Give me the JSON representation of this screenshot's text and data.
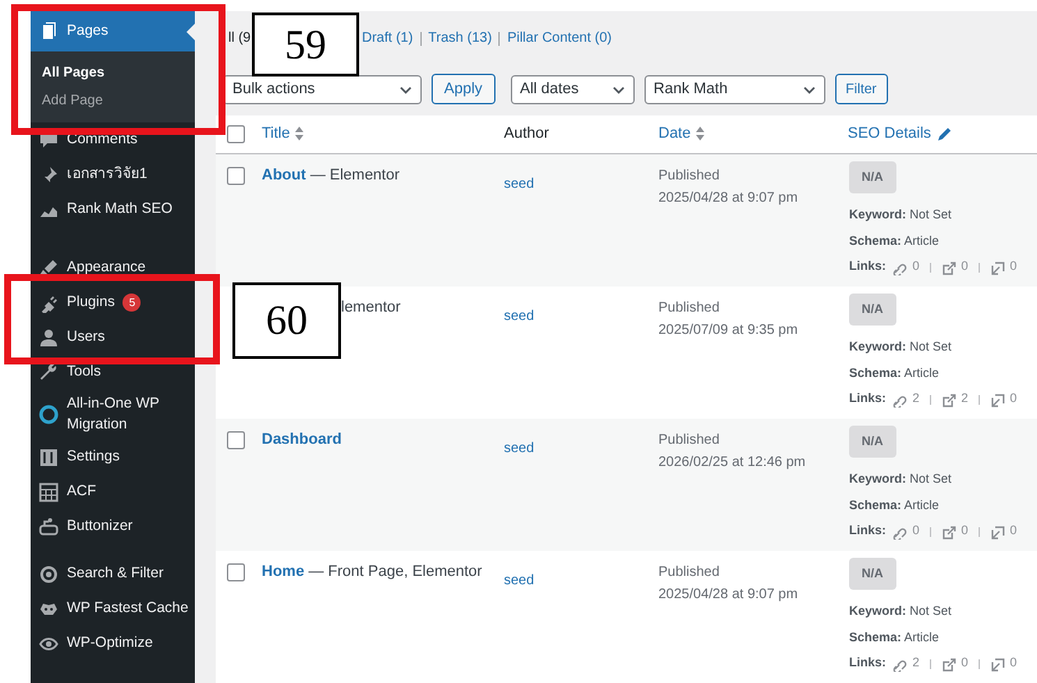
{
  "sidebar": {
    "groups": [
      [
        {
          "label": "Pages",
          "selected": true,
          "children": [
            {
              "label": "All Pages",
              "selected": true
            },
            {
              "label": "Add Page",
              "selected": false
            }
          ]
        },
        {
          "label": "Comments",
          "selected": false
        },
        {
          "label": "เอกสารวิจัย1",
          "selected": false
        },
        {
          "label": "Rank Math SEO",
          "selected": false
        }
      ],
      [
        {
          "label": "Appearance",
          "selected": false
        },
        {
          "label": "Plugins",
          "selected": false,
          "badge": "5"
        },
        {
          "label": "Users",
          "selected": false
        },
        {
          "label": "Tools",
          "selected": false
        },
        {
          "label": "All-in-One WP Migration",
          "selected": false
        },
        {
          "label": "Settings",
          "selected": false
        },
        {
          "label": "ACF",
          "selected": false
        },
        {
          "label": "Buttonizer",
          "selected": false
        }
      ],
      [
        {
          "label": "Search & Filter",
          "selected": false
        },
        {
          "label": "WP Fastest Cache",
          "selected": false
        },
        {
          "label": "WP-Optimize",
          "selected": false
        }
      ]
    ]
  },
  "views": [
    {
      "label": "ll (9"
    },
    {
      "label": "Draft (1)"
    },
    {
      "label": "Trash (13)"
    },
    {
      "label": "Pillar Content (0)"
    }
  ],
  "filters": {
    "bulk_actions": "Bulk actions",
    "apply": "Apply",
    "dates": "All dates",
    "seo_filter": "Rank Math",
    "filter": "Filter"
  },
  "table": {
    "select_all_checked": false,
    "columns": [
      {
        "label": "Title",
        "sortable": true,
        "link": true
      },
      {
        "label": "Author",
        "sortable": false,
        "link": false
      },
      {
        "label": "Date",
        "sortable": true,
        "link": true
      },
      {
        "label": "SEO Details",
        "sortable": false,
        "link": true,
        "editable": true
      }
    ],
    "rows": [
      {
        "checked": false,
        "title": "About",
        "suffix": " — Elementor",
        "author": "seed",
        "status": "Published",
        "date": "2025/04/28 at 9:07 pm",
        "score": "N/A",
        "keyword": "**Keyword:** Not Set",
        "schema": "**Schema:** Article",
        "links_label": "Links:",
        "links": [
          "0",
          "0",
          "0"
        ]
      },
      {
        "suffix": "lementor",
        "author": "seed",
        "status": "Published",
        "date": "2025/07/09 at 9:35 pm",
        "score": "N/A",
        "keyword": "**Keyword:** Not Set",
        "schema": "**Schema:** Article",
        "links_label": "Links:",
        "links": [
          "2",
          "2",
          "0"
        ]
      },
      {
        "checked": false,
        "title": "Dashboard",
        "author": "seed",
        "status": "Published",
        "date": "2026/02/25 at 12:46 pm",
        "score": "N/A",
        "keyword": "**Keyword:** Not Set",
        "schema": "**Schema:** Article",
        "links_label": "Links:",
        "links": [
          "0",
          "0",
          "0"
        ]
      },
      {
        "checked": false,
        "title": "Home",
        "suffix": " — Front Page, Elementor",
        "author": "seed",
        "status": "Published",
        "date": "2025/04/28 at 9:07 pm",
        "score": "N/A",
        "keyword": "**Keyword:** Not Set",
        "schema": "**Schema:** Article",
        "links_label": "Links:",
        "links": [
          "2",
          "0",
          "0"
        ]
      }
    ]
  },
  "annotations": [
    {
      "label": "59"
    },
    {
      "label": "60"
    }
  ]
}
